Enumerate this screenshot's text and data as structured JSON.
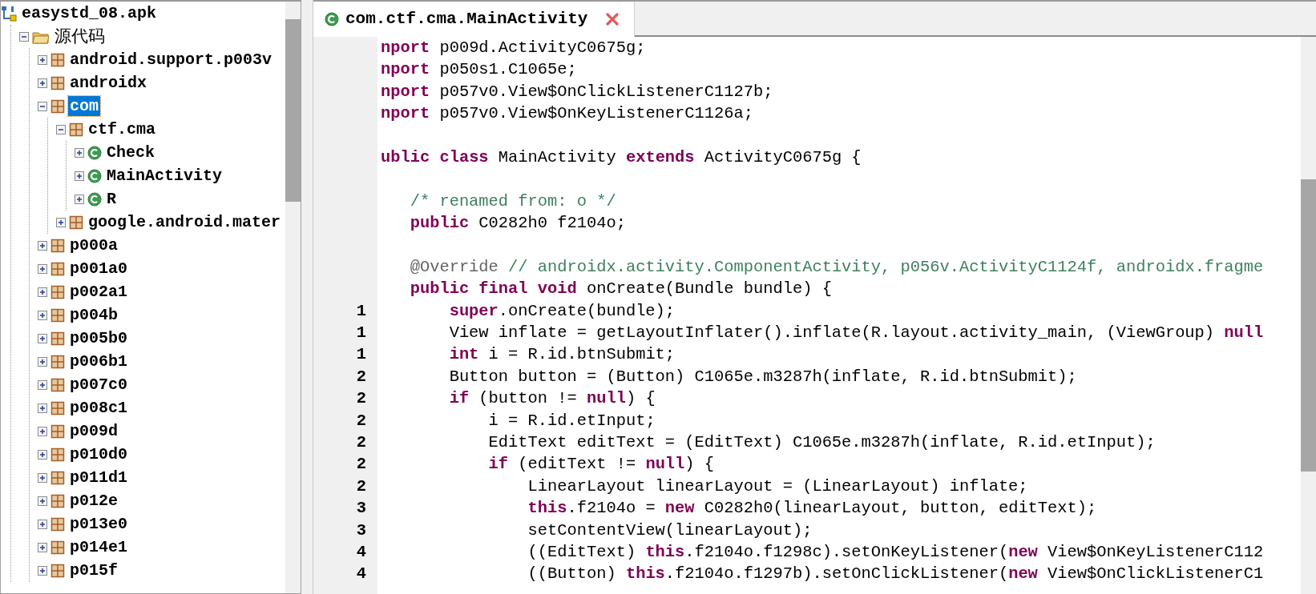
{
  "tree": {
    "items": [
      {
        "label": "easystd_08.apk",
        "kind": "apk",
        "selected": false,
        "children": [
          {
            "label": "源代码",
            "kind": "folder",
            "expanded": true,
            "selected": false,
            "children": [
              {
                "label": "android.support.p003v",
                "kind": "package",
                "expanded": false,
                "selected": false
              },
              {
                "label": "androidx",
                "kind": "package",
                "expanded": false,
                "selected": false
              },
              {
                "label": "com",
                "kind": "package",
                "expanded": true,
                "selected": true,
                "children": [
                  {
                    "label": "ctf.cma",
                    "kind": "package",
                    "expanded": true,
                    "selected": false,
                    "children": [
                      {
                        "label": "Check",
                        "kind": "class",
                        "expanded": false,
                        "selected": false
                      },
                      {
                        "label": "MainActivity",
                        "kind": "class",
                        "expanded": false,
                        "selected": false
                      },
                      {
                        "label": "R",
                        "kind": "class",
                        "expanded": false,
                        "selected": false
                      }
                    ]
                  },
                  {
                    "label": "google.android.mater",
                    "kind": "package",
                    "expanded": false,
                    "selected": false
                  }
                ]
              },
              {
                "label": "p000a",
                "kind": "package",
                "expanded": false,
                "selected": false
              },
              {
                "label": "p001a0",
                "kind": "package",
                "expanded": false,
                "selected": false
              },
              {
                "label": "p002a1",
                "kind": "package",
                "expanded": false,
                "selected": false
              },
              {
                "label": "p004b",
                "kind": "package",
                "expanded": false,
                "selected": false
              },
              {
                "label": "p005b0",
                "kind": "package",
                "expanded": false,
                "selected": false
              },
              {
                "label": "p006b1",
                "kind": "package",
                "expanded": false,
                "selected": false
              },
              {
                "label": "p007c0",
                "kind": "package",
                "expanded": false,
                "selected": false
              },
              {
                "label": "p008c1",
                "kind": "package",
                "expanded": false,
                "selected": false
              },
              {
                "label": "p009d",
                "kind": "package",
                "expanded": false,
                "selected": false
              },
              {
                "label": "p010d0",
                "kind": "package",
                "expanded": false,
                "selected": false
              },
              {
                "label": "p011d1",
                "kind": "package",
                "expanded": false,
                "selected": false
              },
              {
                "label": "p012e",
                "kind": "package",
                "expanded": false,
                "selected": false
              },
              {
                "label": "p013e0",
                "kind": "package",
                "expanded": false,
                "selected": false
              },
              {
                "label": "p014e1",
                "kind": "package",
                "expanded": false,
                "selected": false
              },
              {
                "label": "p015f",
                "kind": "package",
                "expanded": false,
                "selected": false
              }
            ]
          }
        ]
      }
    ]
  },
  "editor": {
    "tabs": [
      {
        "title": "com.ctf.cma.MainActivity",
        "selected": true
      }
    ],
    "lines": [
      {
        "kind": "code",
        "segments": [
          {
            "t": "nport",
            "kind": "keyword"
          },
          {
            "t": " p009d.ActivityC0675g;",
            "kind": "plain"
          }
        ]
      },
      {
        "kind": "code",
        "segments": [
          {
            "t": "nport",
            "kind": "keyword"
          },
          {
            "t": " p050s1.C1065e;",
            "kind": "plain"
          }
        ]
      },
      {
        "kind": "code",
        "segments": [
          {
            "t": "nport",
            "kind": "keyword"
          },
          {
            "t": " p057v0.View$OnClickListenerC1127b;",
            "kind": "plain"
          }
        ]
      },
      {
        "kind": "code",
        "segments": [
          {
            "t": "nport",
            "kind": "keyword"
          },
          {
            "t": " p057v0.View$OnKeyListenerC1126a;",
            "kind": "plain"
          }
        ]
      },
      {
        "kind": "blank"
      },
      {
        "kind": "code",
        "segments": [
          {
            "t": "ublic class",
            "kind": "keyword"
          },
          {
            "t": " MainActivity ",
            "kind": "plain"
          },
          {
            "t": "extends",
            "kind": "keyword"
          },
          {
            "t": " ActivityC0675g {",
            "kind": "plain"
          }
        ]
      },
      {
        "kind": "blank"
      },
      {
        "kind": "code",
        "segments": [
          {
            "t": "   /* renamed from: o */",
            "kind": "comment"
          }
        ]
      },
      {
        "kind": "code",
        "segments": [
          {
            "t": "   public",
            "kind": "keyword"
          },
          {
            "t": " C0282h0 f2104o;",
            "kind": "plain"
          }
        ]
      },
      {
        "kind": "blank"
      },
      {
        "kind": "code",
        "segments": [
          {
            "t": "   @Override",
            "kind": "annotation"
          },
          {
            "t": " // androidx.activity.ComponentActivity, p056v.ActivityC1124f, androidx.fragme",
            "kind": "comment"
          }
        ]
      },
      {
        "kind": "code",
        "segments": [
          {
            "t": "   public final void",
            "kind": "keyword"
          },
          {
            "t": " onCreate(Bundle bundle) {",
            "kind": "plain"
          }
        ]
      },
      {
        "kind": "code",
        "number": "1",
        "segments": [
          {
            "t": "       super",
            "kind": "keyword"
          },
          {
            "t": ".onCreate(bundle);",
            "kind": "plain"
          }
        ]
      },
      {
        "kind": "code",
        "number": "1",
        "segments": [
          {
            "t": "       View inflate = getLayoutInflater().inflate(R.layout.activity_main, (ViewGroup) ",
            "kind": "plain"
          },
          {
            "t": "null",
            "kind": "keyword"
          }
        ]
      },
      {
        "kind": "code",
        "number": "1",
        "segments": [
          {
            "t": "       int",
            "kind": "keyword"
          },
          {
            "t": " i = R.id.btnSubmit;",
            "kind": "plain"
          }
        ]
      },
      {
        "kind": "code",
        "number": "2",
        "segments": [
          {
            "t": "       Button button = (Button) C1065e.m3287h(inflate, R.id.btnSubmit);",
            "kind": "plain"
          }
        ]
      },
      {
        "kind": "code",
        "number": "2",
        "segments": [
          {
            "t": "       if",
            "kind": "keyword"
          },
          {
            "t": " (button != ",
            "kind": "plain"
          },
          {
            "t": "null",
            "kind": "keyword"
          },
          {
            "t": ") {",
            "kind": "plain"
          }
        ]
      },
      {
        "kind": "code",
        "number": "2",
        "segments": [
          {
            "t": "           i = R.id.etInput;",
            "kind": "plain"
          }
        ]
      },
      {
        "kind": "code",
        "number": "2",
        "segments": [
          {
            "t": "           EditText editText = (EditText) C1065e.m3287h(inflate, R.id.etInput);",
            "kind": "plain"
          }
        ]
      },
      {
        "kind": "code",
        "number": "2",
        "segments": [
          {
            "t": "           if",
            "kind": "keyword"
          },
          {
            "t": " (editText != ",
            "kind": "plain"
          },
          {
            "t": "null",
            "kind": "keyword"
          },
          {
            "t": ") {",
            "kind": "plain"
          }
        ]
      },
      {
        "kind": "code",
        "number": "2",
        "segments": [
          {
            "t": "               LinearLayout linearLayout = (LinearLayout) inflate;",
            "kind": "plain"
          }
        ]
      },
      {
        "kind": "code",
        "number": "3",
        "segments": [
          {
            "t": "               this",
            "kind": "keyword"
          },
          {
            "t": ".f2104o = ",
            "kind": "plain"
          },
          {
            "t": "new",
            "kind": "keyword"
          },
          {
            "t": " C0282h0(linearLayout, button, editText);",
            "kind": "plain"
          }
        ]
      },
      {
        "kind": "code",
        "number": "3",
        "segments": [
          {
            "t": "               setContentView(linearLayout);",
            "kind": "plain"
          }
        ]
      },
      {
        "kind": "code",
        "number": "4",
        "segments": [
          {
            "t": "               ((EditText) ",
            "kind": "plain"
          },
          {
            "t": "this",
            "kind": "keyword"
          },
          {
            "t": ".f2104o.f1298c).setOnKeyListener(",
            "kind": "plain"
          },
          {
            "t": "new",
            "kind": "keyword"
          },
          {
            "t": " View$OnKeyListenerC112",
            "kind": "plain"
          }
        ]
      },
      {
        "kind": "code",
        "number": "4",
        "segments": [
          {
            "t": "               ((Button) ",
            "kind": "plain"
          },
          {
            "t": "this",
            "kind": "keyword"
          },
          {
            "t": ".f2104o.f1297b).setOnClickListener(",
            "kind": "plain"
          },
          {
            "t": "new",
            "kind": "keyword"
          },
          {
            "t": " View$OnClickListenerC1",
            "kind": "plain"
          }
        ]
      }
    ]
  }
}
